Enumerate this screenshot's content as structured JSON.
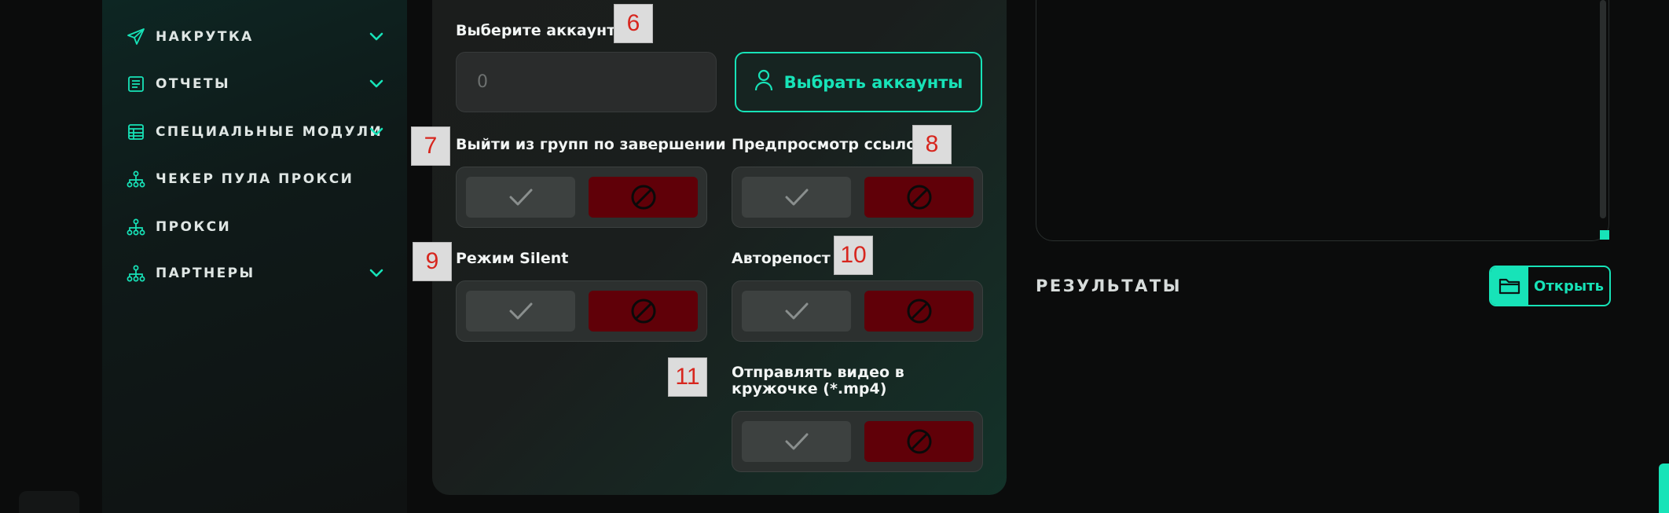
{
  "colors": {
    "accent": "#17e3b8",
    "danger": "#600008",
    "bg": "#0b0c0c"
  },
  "sidebar": {
    "items": [
      {
        "label": "НАКРУТКА",
        "icon": "send-icon",
        "has_chevron": true
      },
      {
        "label": "ОТЧЕТЫ",
        "icon": "report-icon",
        "has_chevron": true
      },
      {
        "label": "СПЕЦИАЛЬНЫЕ МОДУЛИ",
        "icon": "table-icon",
        "has_chevron": true
      },
      {
        "label": "ЧЕКЕР ПУЛА ПРОКСИ",
        "icon": "network-icon",
        "has_chevron": false
      },
      {
        "label": "ПРОКСИ",
        "icon": "network-icon",
        "has_chevron": false
      },
      {
        "label": "ПАРТНЕРЫ",
        "icon": "network-icon",
        "has_chevron": true
      }
    ]
  },
  "settings": {
    "accounts_label": "Выберите аккаунты",
    "accounts_count": "0",
    "pick_accounts_button": "Выбрать аккаунты",
    "leave_groups_label": "Выйти из групп по завершении",
    "link_preview_label": "Предпросмотр ссылок",
    "silent_mode_label": "Режим Silent",
    "autorepost_label": "Авторепост",
    "video_circle_label": "Отправлять видео в кружочке (*.mp4)"
  },
  "markers": [
    "6",
    "7",
    "8",
    "9",
    "10",
    "11"
  ],
  "results": {
    "title": "РЕЗУЛЬТАТЫ",
    "open_button": "Открыть"
  }
}
